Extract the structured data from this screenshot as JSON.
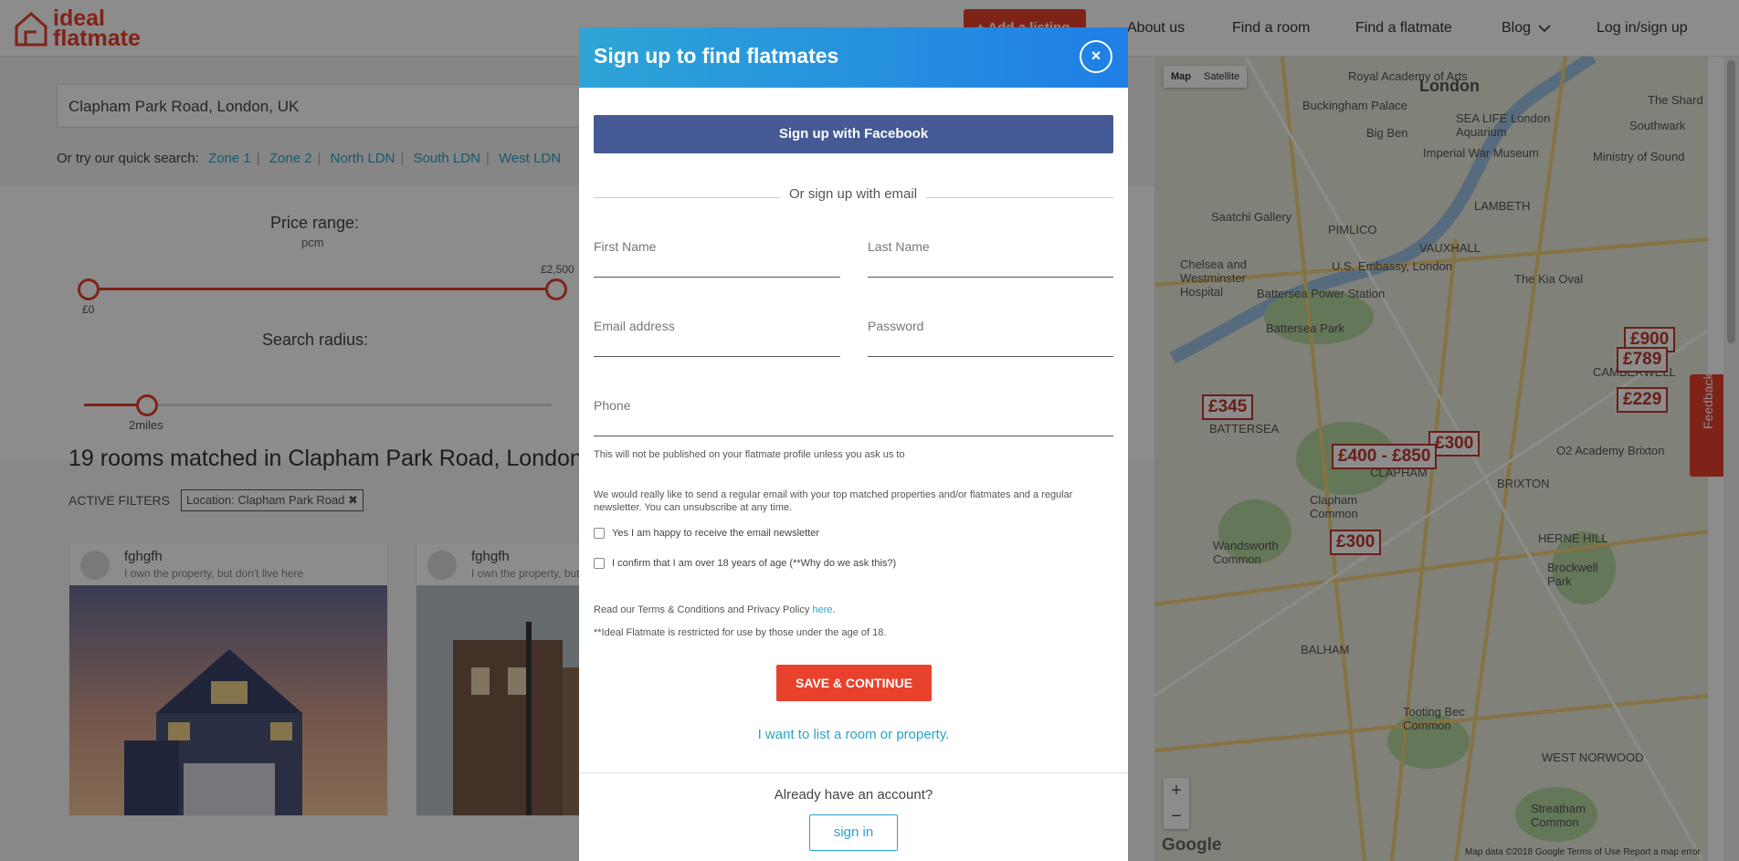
{
  "header": {
    "logo_line1": "ideal",
    "logo_line2": "flatmate",
    "add_listing": "+ Add a listing",
    "nav": [
      "About us",
      "Find a room",
      "Find a flatmate",
      "Blog",
      "Log in/sign up"
    ]
  },
  "search": {
    "value": "Clapham Park Road, London, UK",
    "quick_label": "Or try our quick search:",
    "quick_links": [
      "Zone 1",
      "Zone 2",
      "North LDN",
      "South LDN",
      "West LDN"
    ]
  },
  "filters": {
    "price_label": "Price range:",
    "price_unit": "pcm",
    "price_min": "£0",
    "price_max": "£2,500",
    "radius_label": "Search radius:",
    "radius_value": "2miles"
  },
  "results": {
    "title": "19 rooms matched in Clapham Park Road, London",
    "active_filters_label": "ACTIVE FILTERS",
    "chip": "Location: Clapham Park Road ✖",
    "cards": [
      {
        "name": "fghgfh",
        "sub": "I own the property, but don't live here"
      },
      {
        "name": "fghgfh",
        "sub": "I own the property, but don't live here"
      }
    ]
  },
  "map": {
    "toggle": [
      "Map",
      "Satellite"
    ],
    "pins": [
      "£900",
      "£789",
      "£229",
      "£345",
      "£300",
      "£400 - £850",
      "£300"
    ],
    "labels": [
      "London",
      "Royal Academy of Arts",
      "Buckingham Palace",
      "Big Ben",
      "SEA LIFE London Aquarium",
      "Imperial War Museum",
      "Ministry of Sound",
      "LAMBETH",
      "PIMLICO",
      "VAUXHALL",
      "Battersea Park",
      "BATTERSEA",
      "CLAPHAM",
      "BRIXTON",
      "Clapham Common",
      "HERNE HILL",
      "BALHAM",
      "Tooting Bec Common",
      "WEST NORWOOD",
      "Streatham Common",
      "Wandsworth Common",
      "Brockwell Park",
      "O2 Academy Brixton",
      "The Kia Oval",
      "Saatchi Gallery",
      "Battersea Power Station",
      "U.S. Embassy, London",
      "Chelsea and Westminster Hospital",
      "CAMBERWELL",
      "Southwark",
      "The Shard"
    ],
    "zoom_in": "+",
    "zoom_out": "−",
    "google": "Google",
    "credit": "Map data ©2018 Google   Terms of Use   Report a map error"
  },
  "feedback": "Feedback",
  "modal": {
    "title": "Sign up to find flatmates",
    "close": "×",
    "facebook": "Sign up with Facebook",
    "or_email": "Or sign up with email",
    "first_name": "First Name",
    "last_name": "Last Name",
    "email": "Email address",
    "password": "Password",
    "phone": "Phone",
    "phone_note": "This will not be published on your flatmate profile unless you ask us to",
    "newsletter_note": "We would really like to send a regular email with your top matched properties and/or flatmates and a regular newsletter. You can unsubscribe at any time.",
    "check_newsletter": "Yes I am happy to receive the email newsletter",
    "check_age": "I confirm that I am over 18 years of age (**Why do we ask this?)",
    "terms_text": "Read our Terms & Conditions and Privacy Policy ",
    "terms_link": "here",
    "terms_dot": ".",
    "restriction": "**Ideal Flatmate is restricted for use by those under the age of 18.",
    "save": "SAVE & CONTINUE",
    "list_room": "I want to list a room or property.",
    "have_account": "Already have an account?",
    "sign_in": "sign in"
  }
}
